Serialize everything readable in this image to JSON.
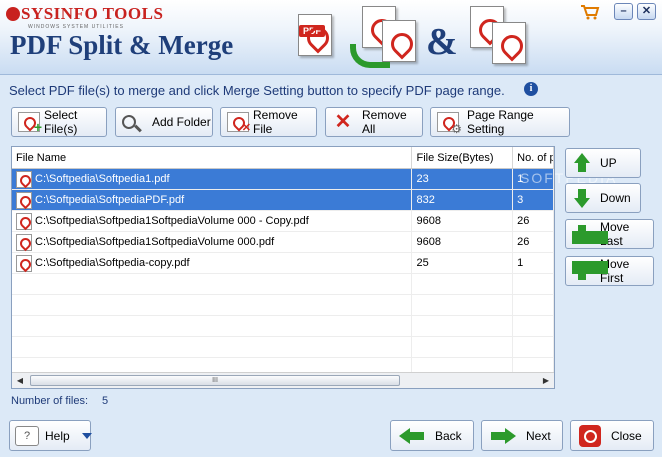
{
  "header": {
    "brand": "SYSINFO TOOLS",
    "brand_sub": "WINDOWS SYSTEM UTILITIES",
    "app_title": "PDF Split & Merge",
    "badge": "PDF",
    "amp": "&",
    "minimize_label": "–",
    "close_label": "✕"
  },
  "instruction": "Select PDF file(s) to merge and click Merge Setting button to specify PDF page range.",
  "info_glyph": "i",
  "toolbar": {
    "select_files": "Select File(s)",
    "add_folder": "Add Folder",
    "remove_file": "Remove File",
    "remove_all": "Remove All",
    "page_range": "Page Range Setting"
  },
  "table": {
    "columns": [
      "File Name",
      "File Size(Bytes)",
      "No. of p"
    ],
    "rows": [
      {
        "name": "C:\\Softpedia\\Softpedia1.pdf",
        "size": "23",
        "pages": "1",
        "selected": true
      },
      {
        "name": "C:\\Softpedia\\SoftpediaPDF.pdf",
        "size": "832",
        "pages": "3",
        "selected": true
      },
      {
        "name": "C:\\Softpedia\\Softpedia1SoftpediaVolume 000 - Copy.pdf",
        "size": "9608",
        "pages": "26",
        "selected": false
      },
      {
        "name": "C:\\Softpedia\\Softpedia1SoftpediaVolume 000.pdf",
        "size": "9608",
        "pages": "26",
        "selected": false
      },
      {
        "name": "C:\\Softpedia\\Softpedia-copy.pdf",
        "size": "25",
        "pages": "1",
        "selected": false
      }
    ],
    "scroll_left": "◀",
    "scroll_right": "▶",
    "scroll_thumb": "III"
  },
  "side": {
    "up": "UP",
    "down": "Down",
    "move_last": "Move Last",
    "move_first": "Move First"
  },
  "watermark": "SOFTPEDIA",
  "status": {
    "label": "Number of files:",
    "count": "5"
  },
  "footer": {
    "help": "Help",
    "help_glyph": "?",
    "back": "Back",
    "next": "Next",
    "close": "Close"
  },
  "colors": {
    "accent": "#1f3f7a",
    "selection": "#3b7bd6",
    "brand_red": "#c8221f",
    "arrow_green": "#2c9a2c"
  }
}
